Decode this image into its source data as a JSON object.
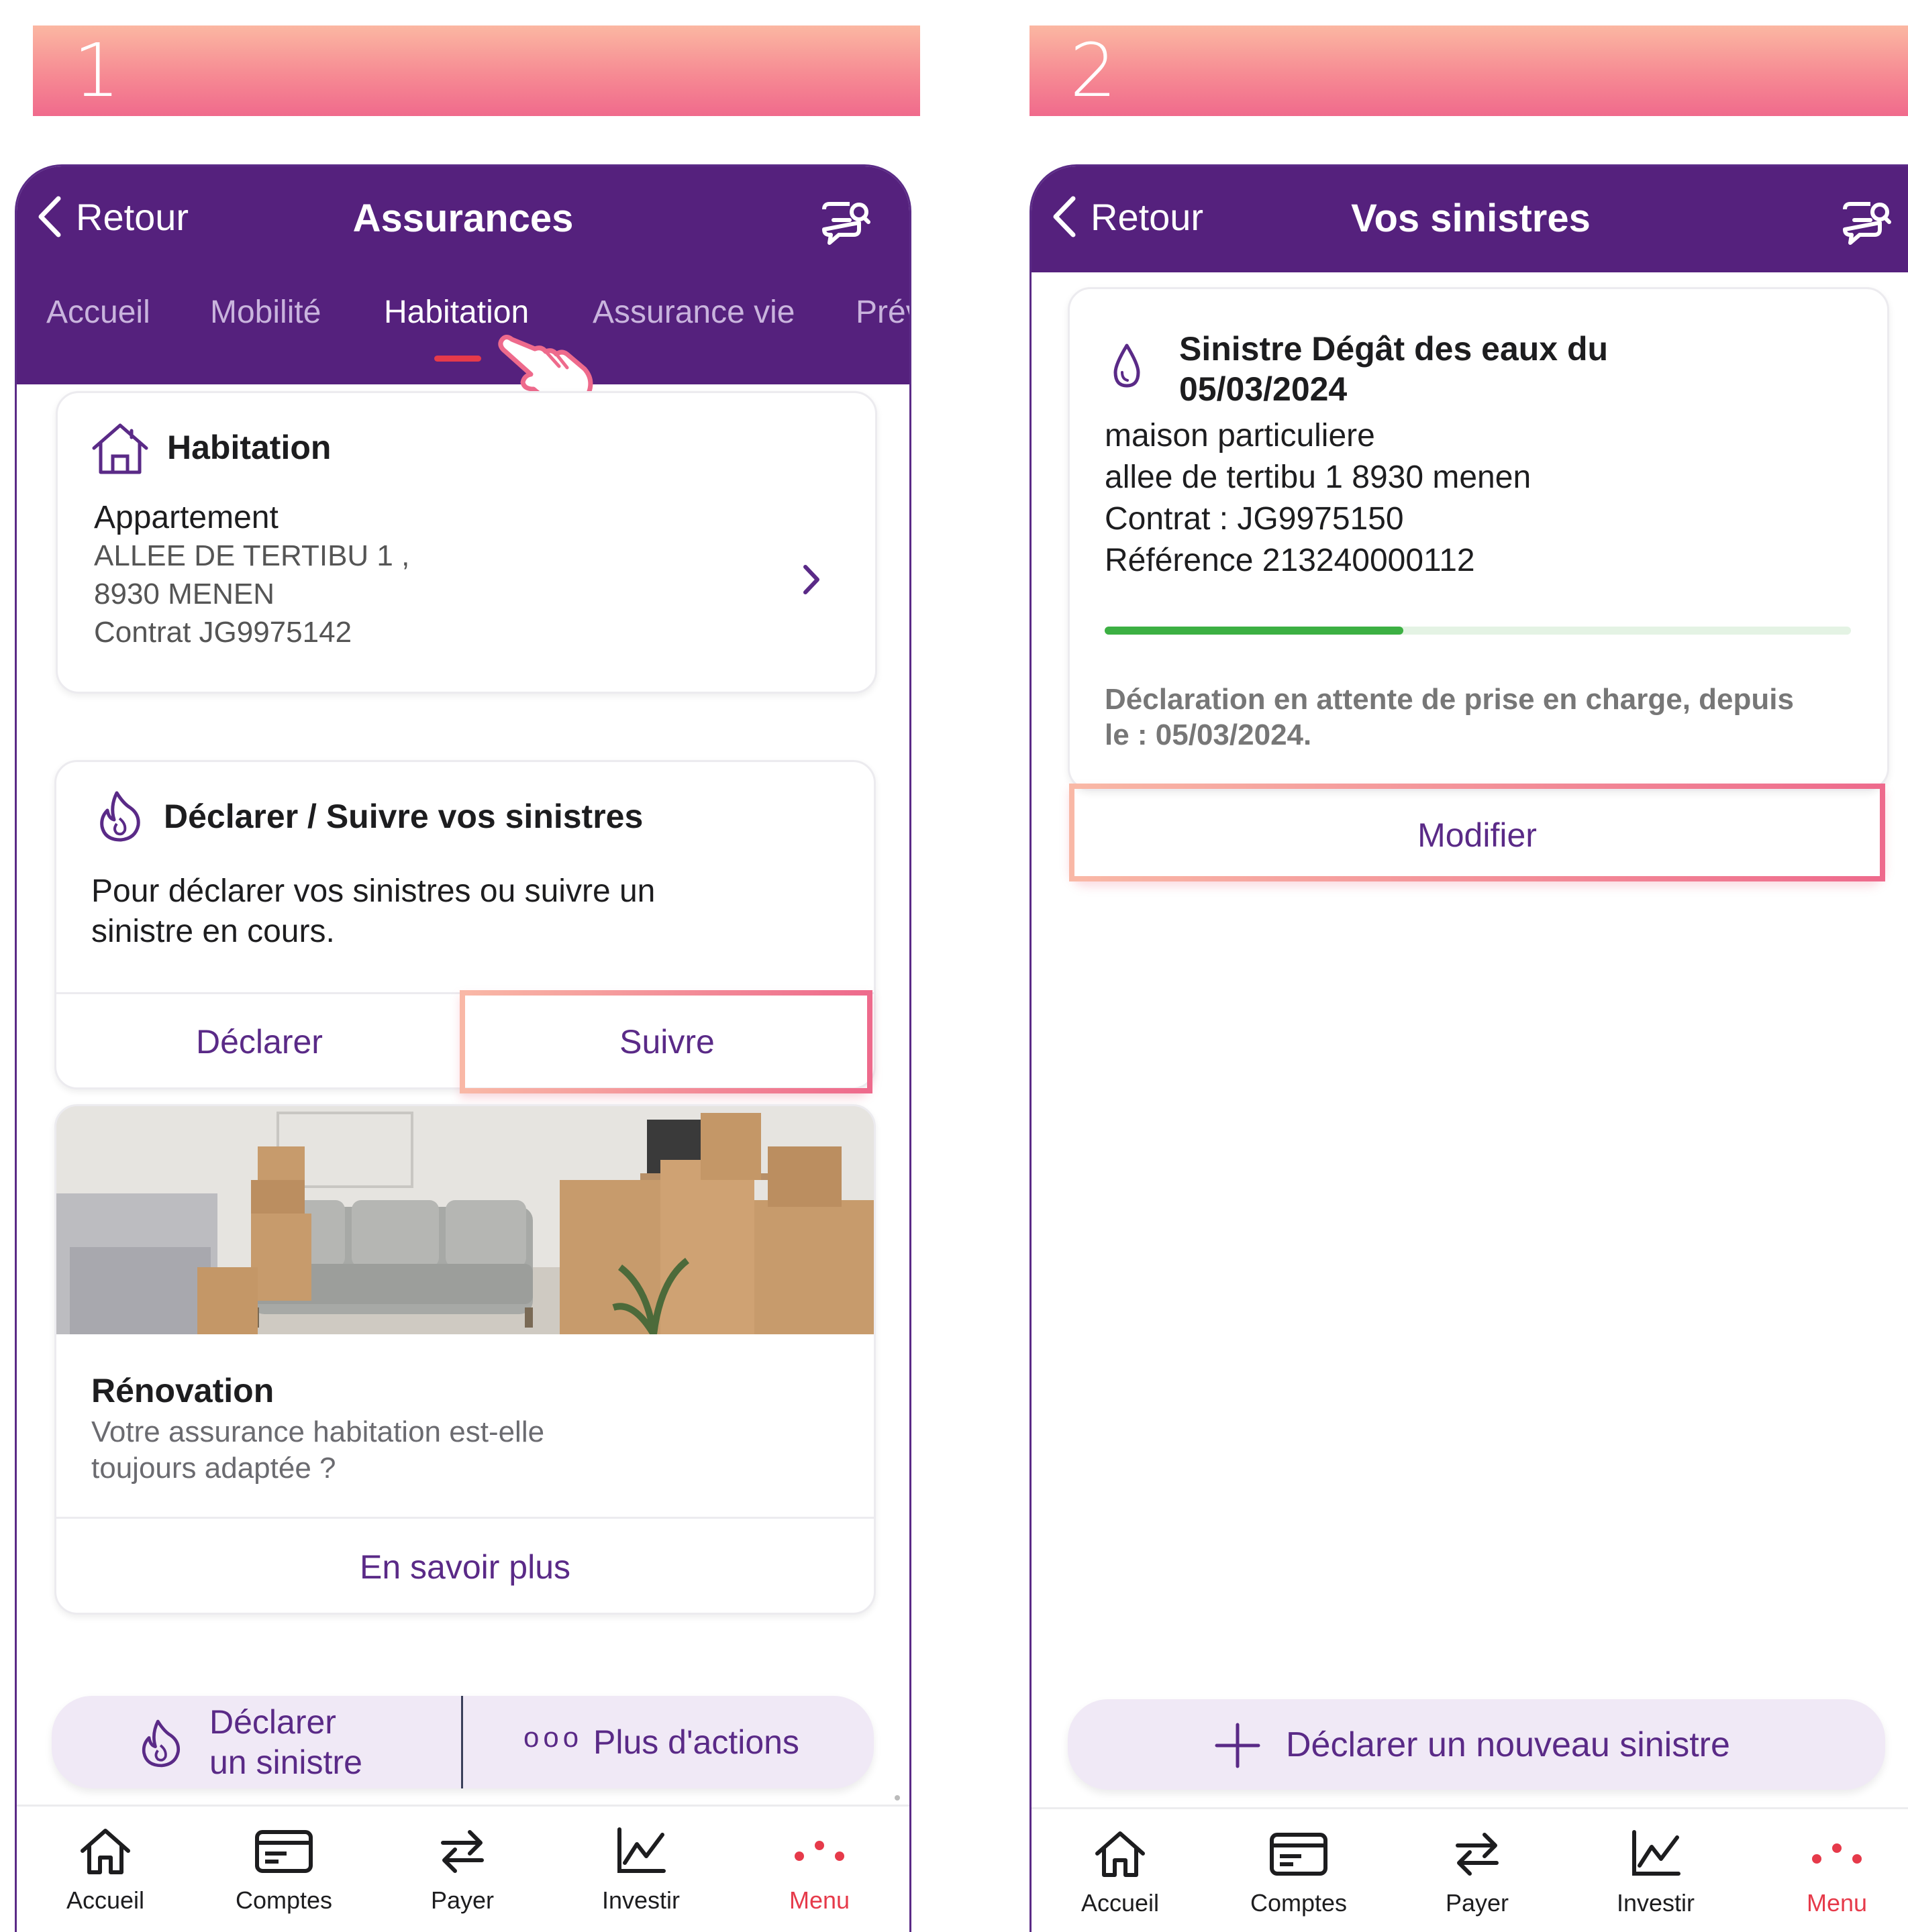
{
  "steps": [
    {
      "number": "1"
    },
    {
      "number": "2"
    }
  ],
  "screen1": {
    "back_label": "Retour",
    "title": "Assurances",
    "tabs": [
      {
        "label": "Accueil"
      },
      {
        "label": "Mobilité"
      },
      {
        "label": "Habitation",
        "active": true
      },
      {
        "label": "Assurance vie"
      },
      {
        "label": "Prév"
      }
    ],
    "habitation_card": {
      "title": "Habitation",
      "type": "Appartement",
      "address_line1": "ALLEE DE TERTIBU 1 ,",
      "address_line2": "8930 MENEN",
      "contract": "Contrat JG9975142"
    },
    "claims_card": {
      "title": "Déclarer / Suivre vos sinistres",
      "line1": "Pour déclarer vos sinistres ou suivre un",
      "line2": "sinistre en cours.",
      "declare_label": "Déclarer",
      "follow_label": "Suivre"
    },
    "renovation_card": {
      "title": "Rénovation",
      "line1": "Votre assurance habitation est-elle",
      "line2": "toujours adaptée ?",
      "cta": "En savoir plus"
    },
    "action_bar": {
      "declare_line1": "Déclarer",
      "declare_line2": "un sinistre",
      "more_label": "Plus d'actions",
      "more_glyph": "ooo"
    }
  },
  "screen2": {
    "back_label": "Retour",
    "title": "Vos sinistres",
    "claim": {
      "title_line1": "Sinistre Dégât des eaux du",
      "title_line2": "05/03/2024",
      "line1": "maison particuliere",
      "line2": "allee de tertibu 1 8930 menen",
      "line3": "Contrat : JG9975150",
      "line4": "Référence 213240000112",
      "progress": 0.4,
      "status_line1": "Déclaration en attente de prise en charge, depuis",
      "status_line2": "le  : 05/03/2024.",
      "modify_label": "Modifier"
    },
    "new_claim_label": "Déclarer un nouveau sinistre"
  },
  "tabbar": {
    "items": [
      {
        "label": "Accueil",
        "icon": "home-icon"
      },
      {
        "label": "Comptes",
        "icon": "card-icon"
      },
      {
        "label": "Payer",
        "icon": "transfer-icon"
      },
      {
        "label": "Investir",
        "icon": "chart-icon"
      },
      {
        "label": "Menu",
        "icon": "dots-icon"
      }
    ]
  },
  "colors": {
    "brand_purple": "#55217d",
    "accent_red": "#e63a4a",
    "highlight_pink": "#f07890",
    "progress_green": "#3cb043"
  }
}
